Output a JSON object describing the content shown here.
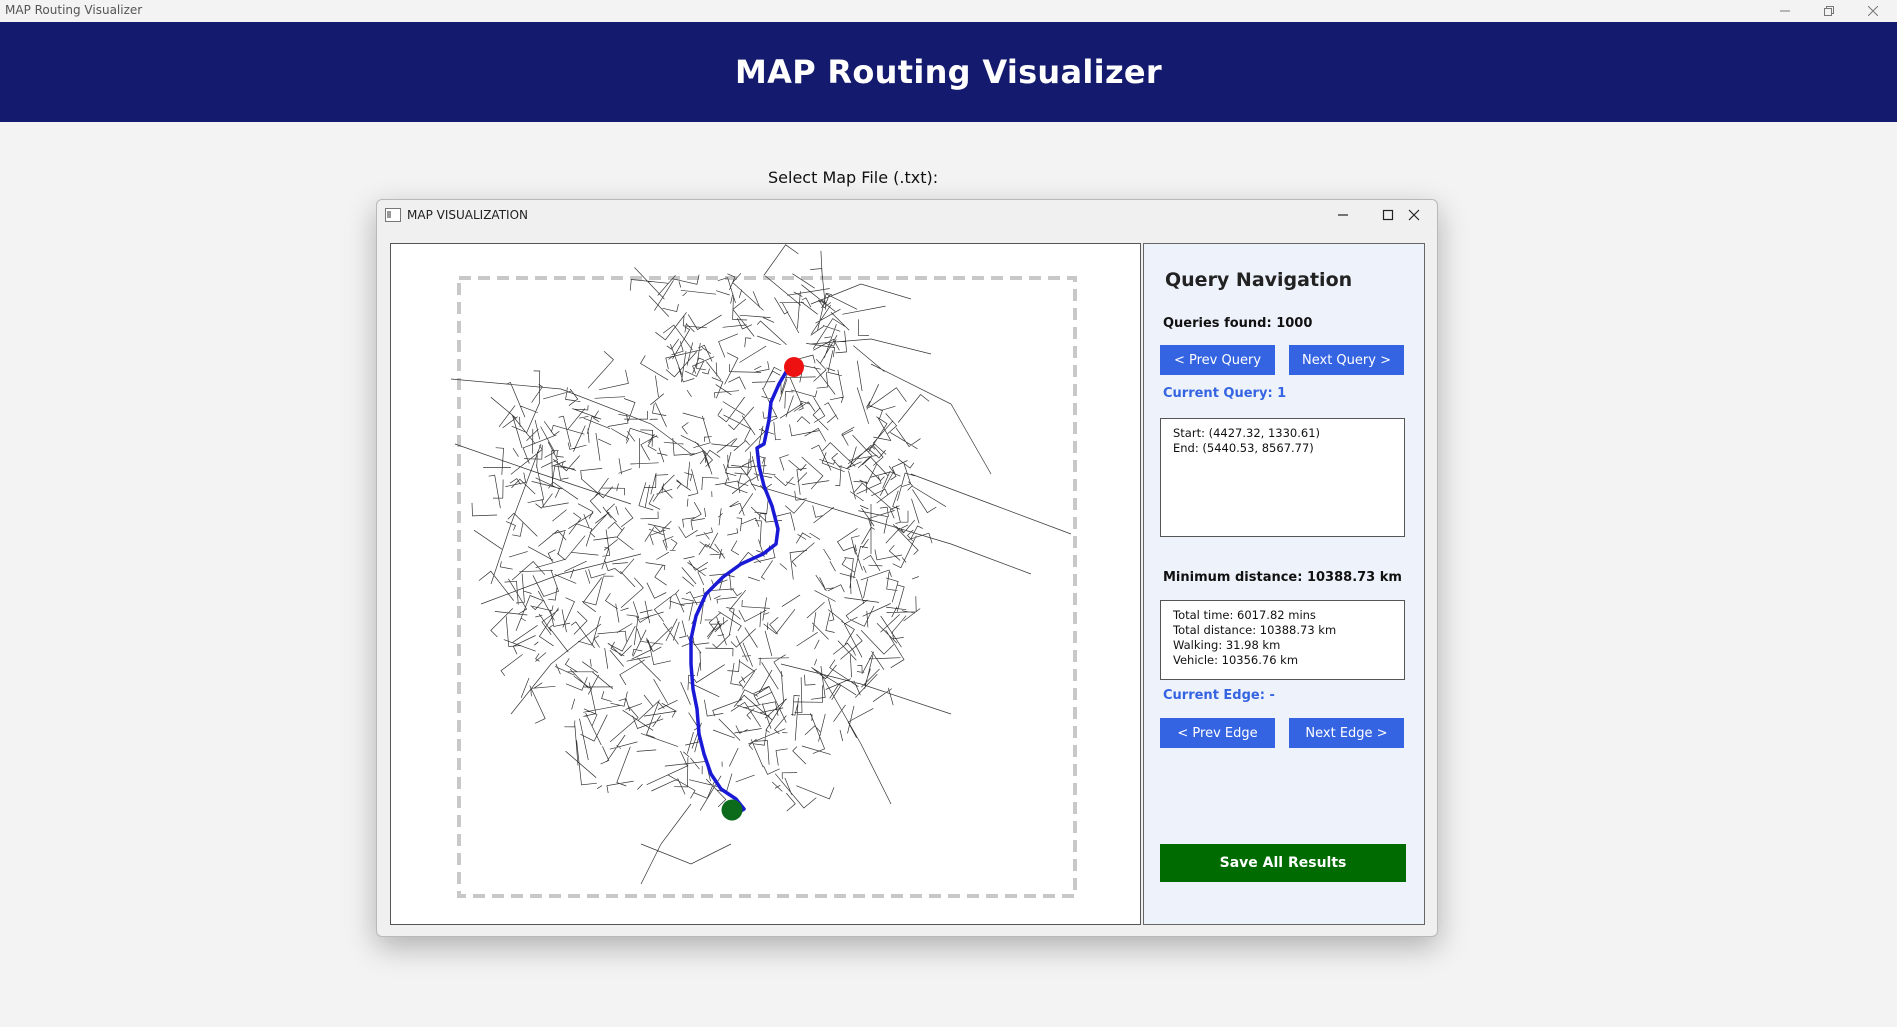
{
  "app": {
    "window_title": "MAP Routing Visualizer",
    "banner_title": "MAP Routing Visualizer"
  },
  "file_select": {
    "label": "Select Map File (.txt):"
  },
  "viz_window": {
    "title": "MAP VISUALIZATION"
  },
  "nav": {
    "title": "Query Navigation",
    "queries_found": "Queries found: 1000",
    "prev_query": "< Prev Query",
    "next_query": "Next Query >",
    "current_query": "Current Query: 1",
    "query_lines": [
      "Start: (4427.32, 1330.61)",
      "End: (5440.53, 8567.77)"
    ],
    "min_distance": "Minimum distance: 10388.73 km",
    "result_lines": [
      "Total time: 6017.82 mins",
      "Total distance: 10388.73 km",
      "Walking: 31.98 km",
      "Vehicle: 10356.76 km"
    ],
    "current_edge": "Current Edge: -",
    "prev_edge": "< Prev Edge",
    "next_edge": "Next Edge >",
    "save_all": "Save All Results"
  },
  "map": {
    "colors": {
      "road": "#333333",
      "route": "#1a1ad6",
      "start": "#ee1111",
      "end": "#0b6b1a",
      "bounds": "#c8c8c8"
    },
    "icons": [
      "minimize-icon",
      "maximize-icon",
      "close-icon",
      "app-window-icon"
    ]
  }
}
